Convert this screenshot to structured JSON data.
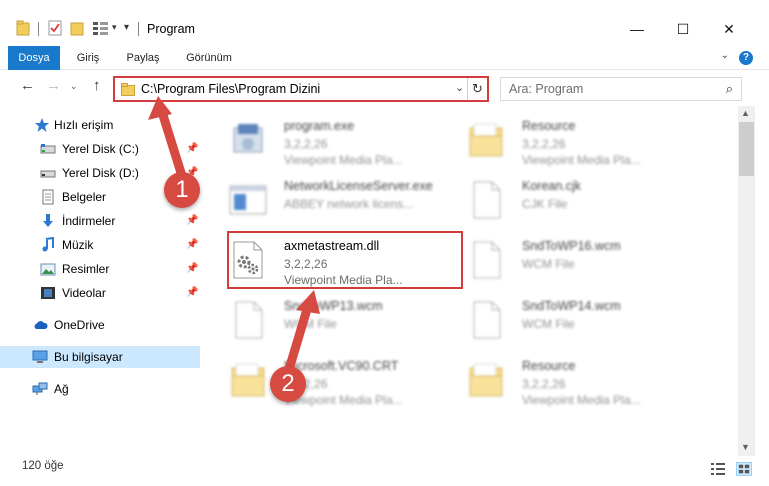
{
  "window": {
    "title": "Program"
  },
  "ribbon": {
    "tabs": [
      {
        "label": "Dosya",
        "active": true
      },
      {
        "label": "Giriş"
      },
      {
        "label": "Paylaş"
      },
      {
        "label": "Görünüm"
      }
    ],
    "help": "?"
  },
  "address": {
    "path": "C:\\Program Files\\Program Dizini"
  },
  "search": {
    "placeholder": "Ara: Program"
  },
  "sidebar": {
    "items": [
      {
        "label": "Hızlı erişim",
        "icon": "star-icon"
      },
      {
        "label": "Yerel Disk (C:)",
        "icon": "drive-icon",
        "pinned": true
      },
      {
        "label": "Yerel Disk (D:)",
        "icon": "drive-icon",
        "pinned": true
      },
      {
        "label": "Belgeler",
        "icon": "documents-icon",
        "pinned": true
      },
      {
        "label": "İndirmeler",
        "icon": "download-icon",
        "pinned": true
      },
      {
        "label": "Müzik",
        "icon": "music-icon",
        "pinned": true
      },
      {
        "label": "Resimler",
        "icon": "pictures-icon",
        "pinned": true
      },
      {
        "label": "Videolar",
        "icon": "video-icon",
        "pinned": true
      },
      {
        "label": "OneDrive",
        "icon": "cloud-icon"
      },
      {
        "label": "Bu bilgisayar",
        "icon": "computer-icon",
        "selected": true
      },
      {
        "label": "Ağ",
        "icon": "network-icon"
      }
    ]
  },
  "files": [
    {
      "name": "program.exe",
      "line1": "3,2,2,26",
      "line2": "Viewpoint Media Pla...",
      "icon": "exe-icon"
    },
    {
      "name": "Resource",
      "line1": "3,2,2,26",
      "line2": "Viewpoint Media Pla...",
      "icon": "folder-icon"
    },
    {
      "name": "NetworkLicenseServer.exe",
      "line1": "ABBEY network licens...",
      "line2": "",
      "icon": "app-window-icon"
    },
    {
      "name": "Korean.cjk",
      "line1": "CJK File",
      "line2": "",
      "icon": "file-icon"
    },
    {
      "name": "axmetastream.dll",
      "line1": "3,2,2,26",
      "line2": "Viewpoint Media Pla...",
      "icon": "dll-gear-icon",
      "highlighted": true
    },
    {
      "name": "SndToWP16.wcm",
      "line1": "WCM File",
      "line2": "",
      "icon": "file-icon"
    },
    {
      "name": "SndToWP13.wcm",
      "line1": "WCM File",
      "line2": "",
      "icon": "file-icon"
    },
    {
      "name": "SndToWP14.wcm",
      "line1": "WCM File",
      "line2": "",
      "icon": "file-icon"
    },
    {
      "name": "Microsoft.VC90.CRT",
      "line1": "3,2,2,26",
      "line2": "Viewpoint Media Pla...",
      "icon": "folder-icon"
    },
    {
      "name": "Resource",
      "line1": "3,2,2,26",
      "line2": "Viewpoint Media Pla...",
      "icon": "folder-icon"
    }
  ],
  "status": {
    "count": "120 öğe"
  },
  "callouts": [
    "1",
    "2"
  ],
  "colors": {
    "accent": "#1979ca",
    "annotation": "#d63b3b",
    "selection": "#cce8ff"
  }
}
